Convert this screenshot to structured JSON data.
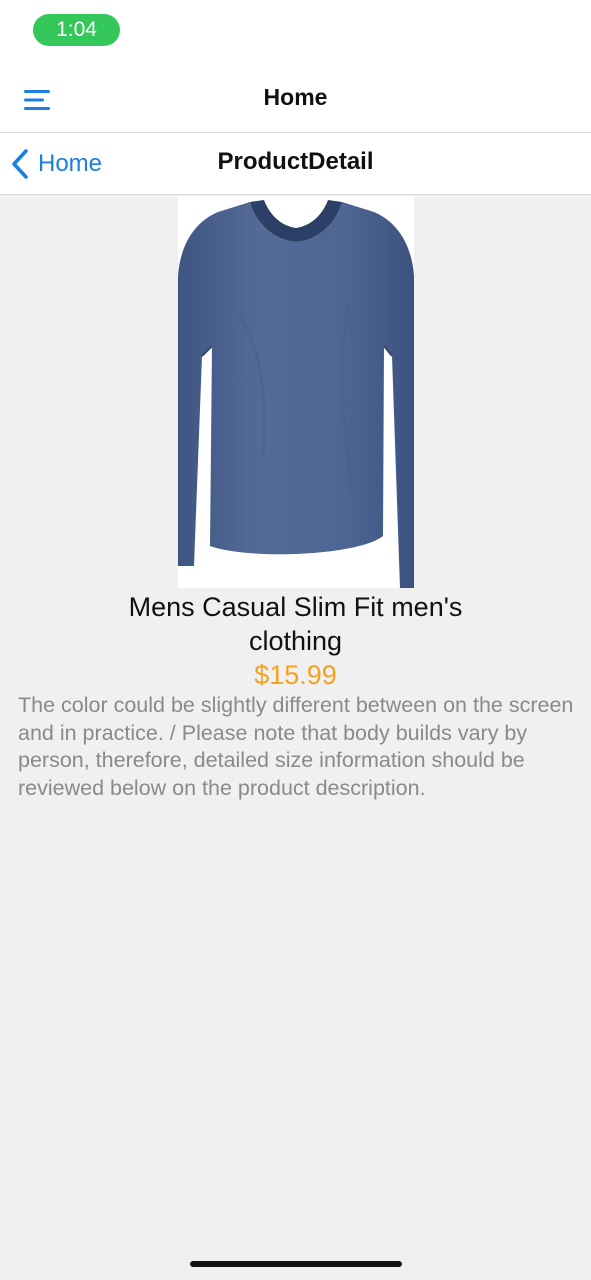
{
  "status_bar": {
    "time": "1:04"
  },
  "top_nav": {
    "title": "Home",
    "menu_icon": "hamburger-menu-icon"
  },
  "sub_nav": {
    "back_label": "Home",
    "title": "ProductDetail",
    "back_icon": "chevron-left-icon"
  },
  "product": {
    "name": "Mens Casual Slim Fit men's clothing",
    "price": "$15.99",
    "description": "The color could be slightly different between on the screen and in practice. / Please note that body builds vary by person, therefore, detailed size information should be reviewed below on the product description.",
    "image": "long-sleeve-v-neck-shirt-image"
  },
  "colors": {
    "accent": "#1a7fe0",
    "price": "#f4a21e",
    "status_pill": "#34c759",
    "background": "#f0f0f0"
  }
}
